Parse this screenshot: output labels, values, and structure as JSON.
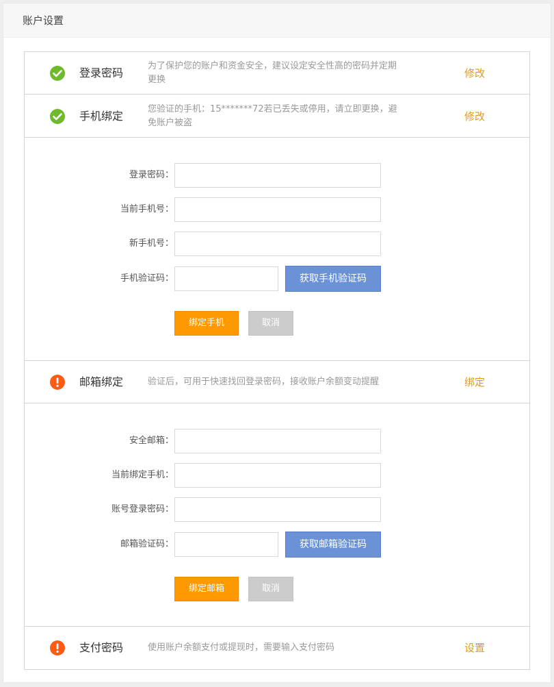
{
  "header": {
    "title": "账户设置"
  },
  "colors": {
    "success": "#6fba2c",
    "warning": "#ff5a16",
    "accent": "#e09a1a",
    "primary_button": "#ff9900",
    "code_button": "#6b92d6"
  },
  "rows": {
    "login_password": {
      "status_icon": "check-circle-icon",
      "title": "登录密码",
      "desc": "为了保护您的账户和资金安全，建议设定安全性高的密码并定期更换",
      "action": "修改"
    },
    "phone_binding": {
      "status_icon": "check-circle-icon",
      "title": "手机绑定",
      "desc": "您验证的手机：15*******72若已丢失或停用，请立即更换，避免账户被盗",
      "action": "修改"
    },
    "email_binding": {
      "status_icon": "exclamation-circle-icon",
      "title": "邮箱绑定",
      "desc": "验证后，可用于快速找回登录密码，接收账户余额变动提醒",
      "action": "绑定"
    },
    "pay_password": {
      "status_icon": "exclamation-circle-icon",
      "title": "支付密码",
      "desc": "使用账户余额支付或提现时，需要输入支付密码",
      "action": "设置"
    }
  },
  "phone_form": {
    "login_password_label": "登录密码：",
    "current_phone_label": "当前手机号：",
    "new_phone_label": "新手机号：",
    "sms_code_label": "手机验证码：",
    "get_code_button": "获取手机验证码",
    "submit_button": "绑定手机",
    "cancel_button": "取消"
  },
  "email_form": {
    "email_label": "安全邮箱：",
    "bound_phone_label": "当前绑定手机：",
    "account_password_label": "账号登录密码：",
    "email_code_label": "邮箱验证码：",
    "get_code_button": "获取邮箱验证码",
    "submit_button": "绑定邮箱",
    "cancel_button": "取消"
  }
}
